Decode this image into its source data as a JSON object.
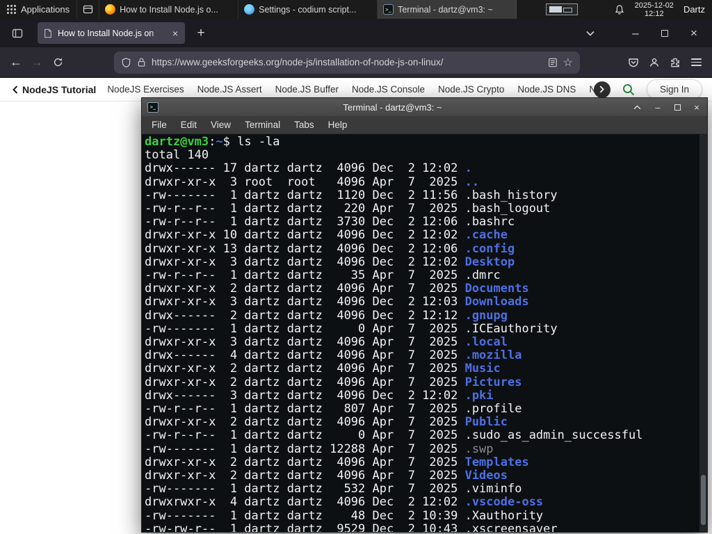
{
  "taskbar": {
    "applications": "Applications",
    "windows": [
      {
        "icon": "firefox",
        "title": "How to Install Node.js o...",
        "active": false
      },
      {
        "icon": "settings",
        "title": "Settings - codium script...",
        "active": false
      },
      {
        "icon": "terminal",
        "title": "Terminal - dartz@vm3: ~",
        "active": true
      }
    ],
    "clock_date": "2025-12-02",
    "clock_time": "12:12",
    "user": "Dartz"
  },
  "browser": {
    "tab_title": "How to Install Node.js on",
    "url": "https://www.geeksforgeeks.org/node-js/installation-of-node-js-on-linux/"
  },
  "site_nav": {
    "tutorial": "NodeJS Tutorial",
    "items": [
      "NodeJS Exercises",
      "Node.JS Assert",
      "Node.JS Buffer",
      "Node.JS Console",
      "Node.JS Crypto",
      "Node.JS DNS",
      "Node"
    ],
    "sign_in": "Sign In",
    "accent_green": "#2f8d46"
  },
  "icons": {
    "close": "×",
    "plus": "+",
    "minimize": "–",
    "back": "←",
    "forward": "→",
    "star": "☆",
    "terminal_glyph": ">_"
  },
  "terminal": {
    "title": "Terminal - dartz@vm3: ~",
    "menus": [
      "File",
      "Edit",
      "View",
      "Terminal",
      "Tabs",
      "Help"
    ],
    "prompt_user": "dartz@vm3",
    "prompt_colon": ":",
    "prompt_path": "~",
    "prompt_dollar": "$ ",
    "command": "ls -la",
    "total": "total 140",
    "colors": {
      "prompt_green": "#3fd03f",
      "dir_blue": "#4d6fe3",
      "text": "#f2f2f2",
      "dim": "#8a8a8a",
      "background": "#0d1013"
    },
    "listing": [
      {
        "pre": "drwx------ 17 dartz dartz  4096 Dec  2 12:02 ",
        "name": ".",
        "type": "dir"
      },
      {
        "pre": "drwxr-xr-x  3 root  root   4096 Apr  7  2025 ",
        "name": "..",
        "type": "dir"
      },
      {
        "pre": "-rw-------  1 dartz dartz  1120 Dec  2 11:56 ",
        "name": ".bash_history",
        "type": "file"
      },
      {
        "pre": "-rw-r--r--  1 dartz dartz   220 Apr  7  2025 ",
        "name": ".bash_logout",
        "type": "file"
      },
      {
        "pre": "-rw-r--r--  1 dartz dartz  3730 Dec  2 12:06 ",
        "name": ".bashrc",
        "type": "file"
      },
      {
        "pre": "drwxr-xr-x 10 dartz dartz  4096 Dec  2 12:02 ",
        "name": ".cache",
        "type": "dir"
      },
      {
        "pre": "drwxr-xr-x 13 dartz dartz  4096 Dec  2 12:06 ",
        "name": ".config",
        "type": "dir"
      },
      {
        "pre": "drwxr-xr-x  3 dartz dartz  4096 Dec  2 12:02 ",
        "name": "Desktop",
        "type": "dir"
      },
      {
        "pre": "-rw-r--r--  1 dartz dartz    35 Apr  7  2025 ",
        "name": ".dmrc",
        "type": "file"
      },
      {
        "pre": "drwxr-xr-x  2 dartz dartz  4096 Apr  7  2025 ",
        "name": "Documents",
        "type": "dir"
      },
      {
        "pre": "drwxr-xr-x  3 dartz dartz  4096 Dec  2 12:03 ",
        "name": "Downloads",
        "type": "dir"
      },
      {
        "pre": "drwx------  2 dartz dartz  4096 Dec  2 12:12 ",
        "name": ".gnupg",
        "type": "dir"
      },
      {
        "pre": "-rw-------  1 dartz dartz     0 Apr  7  2025 ",
        "name": ".ICEauthority",
        "type": "file"
      },
      {
        "pre": "drwxr-xr-x  3 dartz dartz  4096 Apr  7  2025 ",
        "name": ".local",
        "type": "dir"
      },
      {
        "pre": "drwx------  4 dartz dartz  4096 Apr  7  2025 ",
        "name": ".mozilla",
        "type": "dir"
      },
      {
        "pre": "drwxr-xr-x  2 dartz dartz  4096 Apr  7  2025 ",
        "name": "Music",
        "type": "dir"
      },
      {
        "pre": "drwxr-xr-x  2 dartz dartz  4096 Apr  7  2025 ",
        "name": "Pictures",
        "type": "dir"
      },
      {
        "pre": "drwx------  3 dartz dartz  4096 Dec  2 12:02 ",
        "name": ".pki",
        "type": "dir"
      },
      {
        "pre": "-rw-r--r--  1 dartz dartz   807 Apr  7  2025 ",
        "name": ".profile",
        "type": "file"
      },
      {
        "pre": "drwxr-xr-x  2 dartz dartz  4096 Apr  7  2025 ",
        "name": "Public",
        "type": "dir"
      },
      {
        "pre": "-rw-r--r--  1 dartz dartz     0 Apr  7  2025 ",
        "name": ".sudo_as_admin_successful",
        "type": "file"
      },
      {
        "pre": "-rw-------  1 dartz dartz 12288 Apr  7  2025 ",
        "name": ".swp",
        "type": "dim"
      },
      {
        "pre": "drwxr-xr-x  2 dartz dartz  4096 Apr  7  2025 ",
        "name": "Templates",
        "type": "dir"
      },
      {
        "pre": "drwxr-xr-x  2 dartz dartz  4096 Apr  7  2025 ",
        "name": "Videos",
        "type": "dir"
      },
      {
        "pre": "-rw-------  1 dartz dartz   532 Apr  7  2025 ",
        "name": ".viminfo",
        "type": "file"
      },
      {
        "pre": "drwxrwxr-x  4 dartz dartz  4096 Dec  2 12:02 ",
        "name": ".vscode-oss",
        "type": "dir"
      },
      {
        "pre": "-rw-------  1 dartz dartz    48 Dec  2 10:39 ",
        "name": ".Xauthority",
        "type": "file"
      },
      {
        "pre": "-rw-rw-r--  1 dartz dartz  9529 Dec  2 10:43 ",
        "name": ".xscreensaver",
        "type": "file"
      }
    ]
  }
}
